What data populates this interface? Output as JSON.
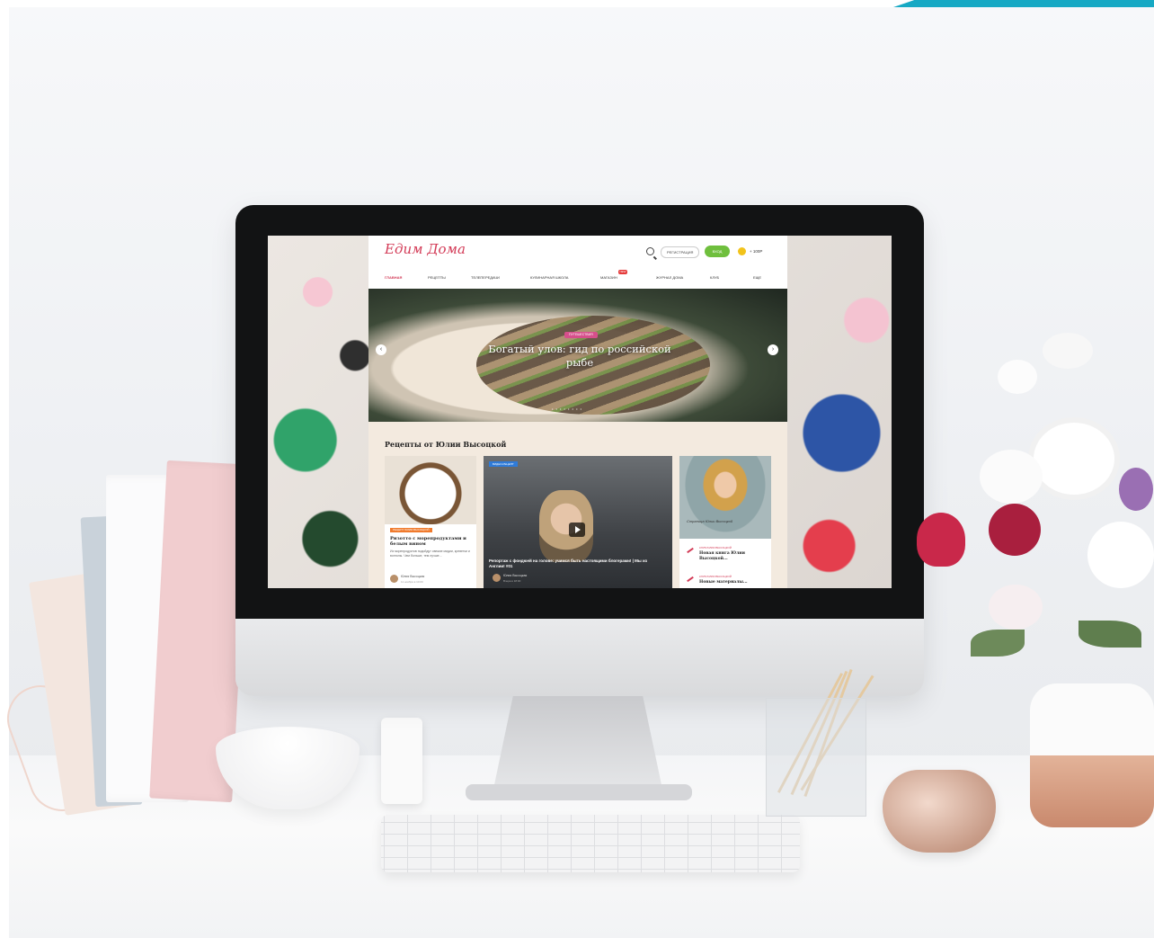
{
  "site": {
    "logo": "Едим Дома",
    "header": {
      "register_label": "РЕГИСТРАЦИЯ",
      "login_label": "ВХОД",
      "balance": "+ 100Р"
    },
    "nav": [
      {
        "label": "ГЛАВНАЯ",
        "active": true
      },
      {
        "label": "РЕЦЕПТЫ"
      },
      {
        "label": "ТЕЛЕПЕРЕДАЧИ"
      },
      {
        "label": "КУЛИНАРНАЯ ШКОЛА"
      },
      {
        "label": "МАГАЗИН",
        "badge": "NEW"
      },
      {
        "label": "ЖУРНАЛ ДОМА"
      },
      {
        "label": "КЛУБ"
      },
      {
        "label": "ЕЩЕ"
      }
    ],
    "hero": {
      "tag": "ПУТЕШЕСТВИЯ",
      "title": "Богатый улов: гид по российской рыбе"
    },
    "section": {
      "title": "Рецепты от Юлии Высоцкой",
      "cards": [
        {
          "badge": "РЕЦЕПТ ЮЛИИ ВЫСОЦКОЙ",
          "title": "Ризотто с морепродуктами и белым вином",
          "text": "Из морепродуктов подойдут свежие мидии, креветки и вонголы. Чем больше, тем лучше...",
          "author": "Юлия Высоцкая",
          "author_sub": "11 ноября в 10:00"
        },
        {
          "badge": "ВИДЕО-РЕЦЕПТ",
          "title": "Репортаж с фондюей на голове: учимся быть настоящими блогерами! | Мы из Англии! #01",
          "author": "Юлия Высоцкая",
          "author_sub": "Вчера в 18:00"
        },
        {
          "caption": "Страница Юлии Высоцкой",
          "items": [
            {
              "tag": "КЛУБ ЮЛИИ ВЫСОЦКОЙ",
              "title": "Новая книга Юлии Высоцкой..."
            },
            {
              "tag": "КЛУБ ЮЛИИ ВЫСОЦКОЙ",
              "title": "Новые материалы..."
            }
          ]
        }
      ]
    }
  },
  "colors": {
    "brand": "#d33b57",
    "login_green": "#6fbf3d",
    "accent_teal": "#16a9c4"
  },
  "icons": [
    "search-icon",
    "coin-icon",
    "play-icon",
    "pen-icon",
    "arrow-left-icon",
    "arrow-right-icon"
  ]
}
